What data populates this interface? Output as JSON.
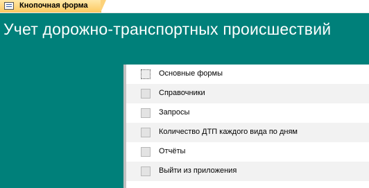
{
  "tab": {
    "label": "Кнопочная форма",
    "icon": "form-icon"
  },
  "form": {
    "title": "Учет дорожно-транспортных происшествий",
    "colors": {
      "header": "#00807a",
      "row_alt": "#f2f2f2",
      "tab": "#fcc860"
    },
    "items": [
      {
        "label": "Основные формы"
      },
      {
        "label": "Справочники"
      },
      {
        "label": "Запросы"
      },
      {
        "label": "Количество ДТП каждого вида по дням"
      },
      {
        "label": "Отчёты"
      },
      {
        "label": "Выйти из приложения"
      }
    ]
  }
}
